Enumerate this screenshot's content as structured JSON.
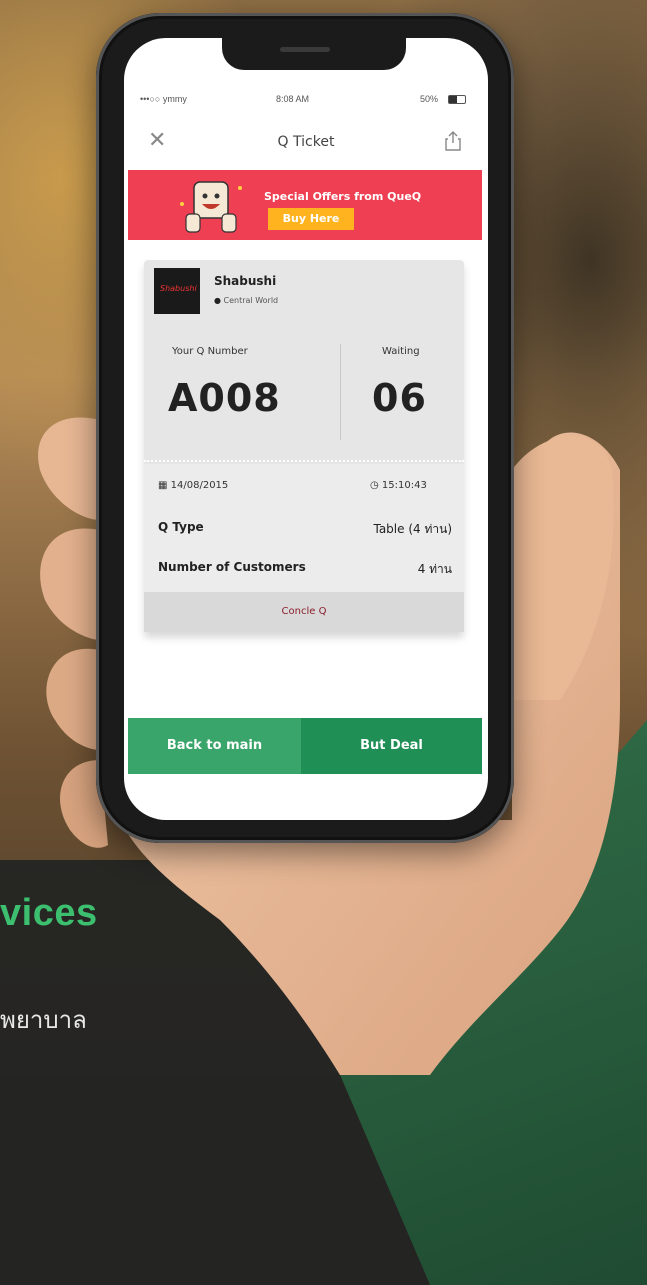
{
  "caption": {
    "title": "vices",
    "subtitle": "พยาบาล"
  },
  "status_bar": {
    "carrier": "•••○○ ymmy",
    "time": "8:08 AM",
    "battery": "50%"
  },
  "nav": {
    "title": "Q Ticket",
    "close_icon": "close-icon",
    "share_icon": "share-icon"
  },
  "promo": {
    "text": "Special Offers from QueQ",
    "button": "Buy Here"
  },
  "shop": {
    "name": "Shabushi",
    "location": "Central World"
  },
  "queue": {
    "number_label": "Your Q Number",
    "number": "A008",
    "waiting_label": "Waiting",
    "waiting": "06"
  },
  "details": {
    "date": "14/08/2015",
    "time": "15:10:43",
    "type_label": "Q Type",
    "type_value": "Table (4 ท่าน)",
    "customers_label": "Number of Customers",
    "customers_value": "4 ท่าน"
  },
  "cancel_label": "Concle Q",
  "buttons": {
    "back": "Back to main",
    "deal": "But Deal"
  },
  "colors": {
    "promo": "#ee3f53",
    "promo_button": "#ffb31f",
    "back_button": "#3aa56b",
    "deal_button": "#1f8f55",
    "caption_green": "#3cbf6e"
  }
}
